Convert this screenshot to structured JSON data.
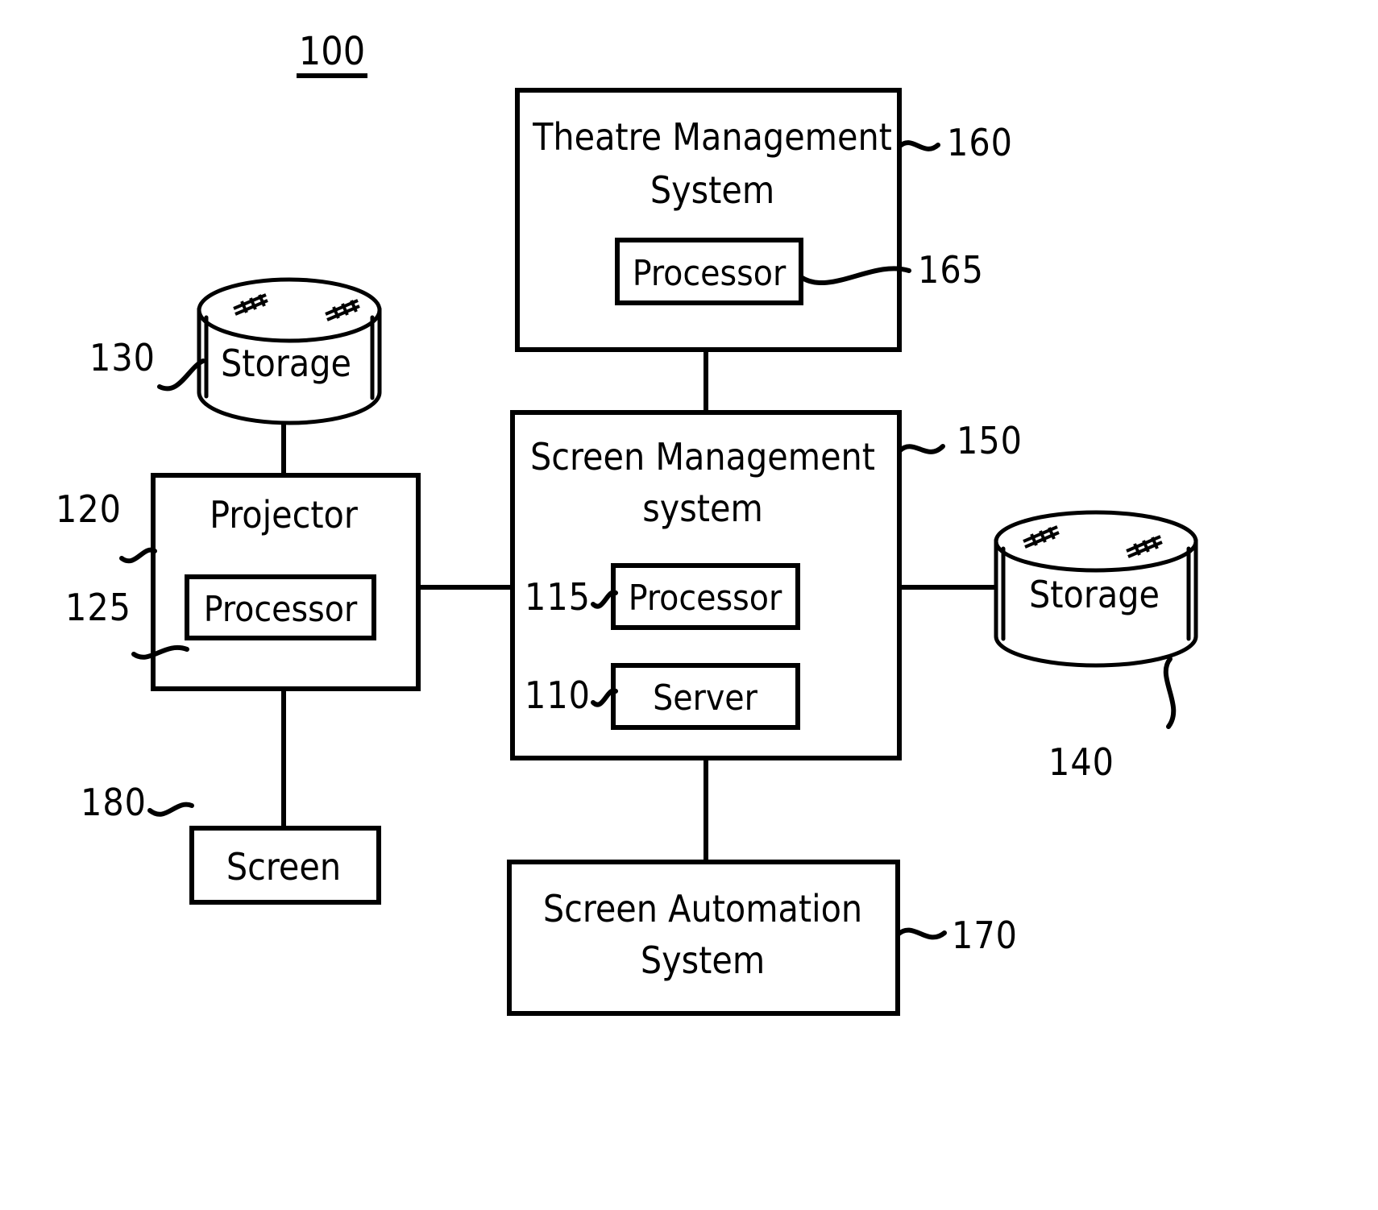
{
  "figure": {
    "title": "100",
    "title_underlined": true
  },
  "blocks": [
    {
      "id": "theatre-management-system",
      "label_lines": [
        "Theatre  Management",
        "System"
      ],
      "ref": "160",
      "inner": {
        "id": "tms-processor",
        "label": "Processor",
        "ref": "165"
      }
    },
    {
      "id": "screen-management-system",
      "label_lines": [
        "Screen  Management",
        "system"
      ],
      "ref": "150",
      "inner_items": [
        {
          "id": "sms-processor",
          "label": "Processor",
          "ref": "115"
        },
        {
          "id": "sms-server",
          "label": "Server",
          "ref": "110"
        }
      ]
    },
    {
      "id": "projector",
      "label_lines": [
        "Projector"
      ],
      "ref": "120",
      "inner": {
        "id": "projector-processor",
        "label": "Processor",
        "ref": "125"
      }
    },
    {
      "id": "screen",
      "label_lines": [
        "Screen"
      ],
      "ref": "180"
    },
    {
      "id": "screen-automation-system",
      "label_lines": [
        "Screen  Automation",
        "System"
      ],
      "ref": "170"
    }
  ],
  "cylinders": [
    {
      "id": "storage-left",
      "label": "Storage",
      "ref": "130"
    },
    {
      "id": "storage-right",
      "label": "Storage",
      "ref": "140"
    }
  ],
  "connections": [
    {
      "from": "theatre-management-system",
      "to": "screen-management-system"
    },
    {
      "from": "storage-left",
      "to": "projector"
    },
    {
      "from": "projector",
      "to": "screen-management-system"
    },
    {
      "from": "projector",
      "to": "screen"
    },
    {
      "from": "screen-management-system",
      "to": "storage-right"
    },
    {
      "from": "screen-management-system",
      "to": "screen-automation-system"
    }
  ],
  "colors": {
    "ink": "#000000",
    "paper": "#ffffff"
  }
}
